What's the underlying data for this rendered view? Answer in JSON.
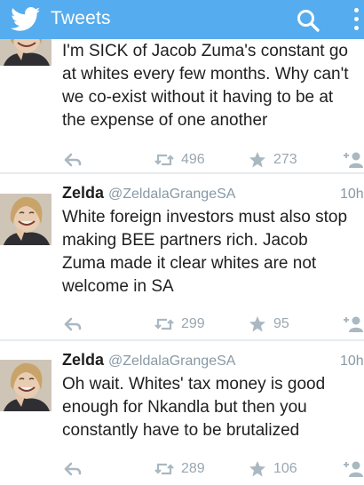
{
  "app": {
    "title": "Tweets"
  },
  "tweets": [
    {
      "name": "",
      "handle": "",
      "time": "",
      "lines": [
        "I'm SICK of Jacob Zuma's constant go",
        "at whites every few months. Why can't",
        "we co-exist without it having to be at",
        "the expense of one another"
      ],
      "retweets": "496",
      "favorites": "273"
    },
    {
      "name": "Zelda",
      "handle": "@ZeldalaGrangeSA",
      "time": "10h",
      "lines": [
        "White foreign investors must also stop",
        "making BEE partners rich.  Jacob",
        "Zuma made it clear whites are not",
        "welcome in SA"
      ],
      "retweets": "299",
      "favorites": "95"
    },
    {
      "name": "Zelda",
      "handle": "@ZeldalaGrangeSA",
      "time": "10h",
      "lines": [
        "Oh wait.  Whites' tax money is good",
        "enough for Nkandla but then you",
        "constantly have to be brutalized"
      ],
      "retweets": "289",
      "favorites": "106"
    }
  ],
  "colors": {
    "appbar": "#55acee",
    "icon_gray": "#aab8c2",
    "meta_gray": "#8899a6"
  }
}
